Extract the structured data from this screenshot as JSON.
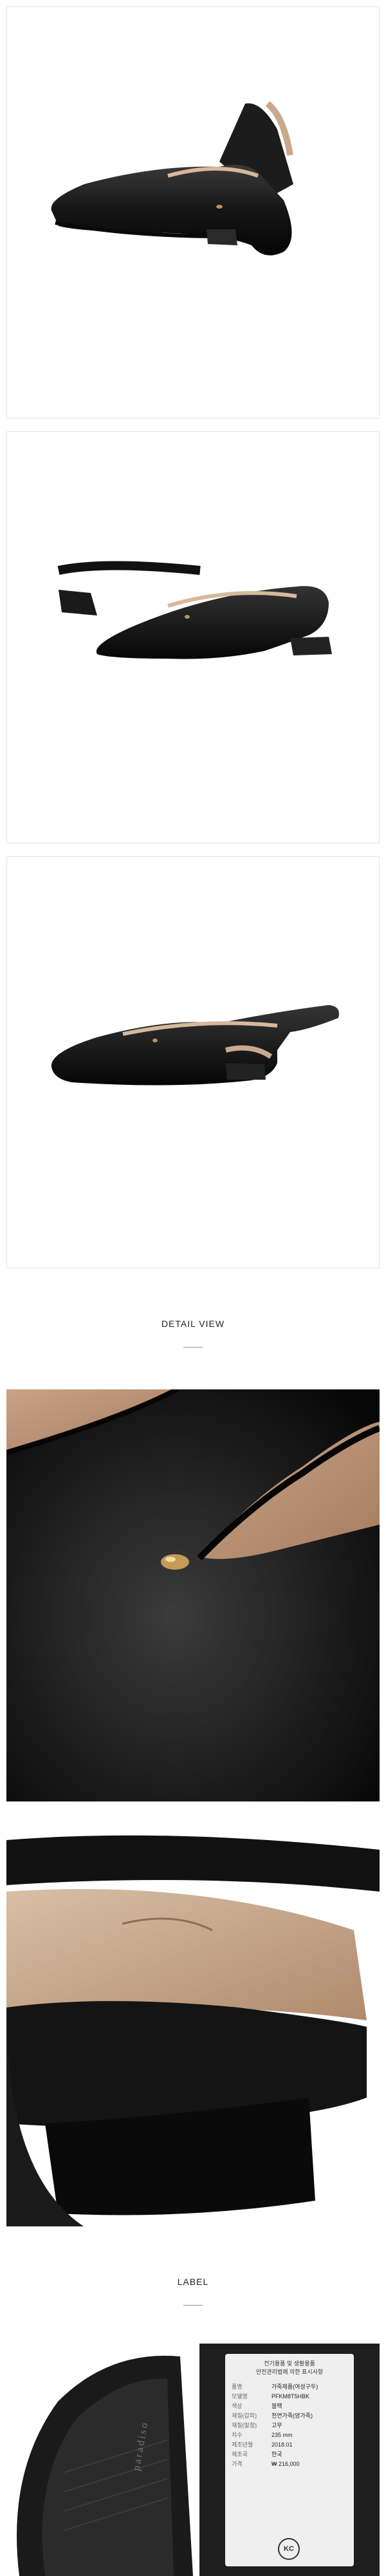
{
  "sections": {
    "detail_heading": "DETAIL VIEW",
    "label_heading": "LABEL"
  },
  "label_card": {
    "title_line1": "전기용품 및 생활용품",
    "title_line2": "안전관리법에 의한 표시사항",
    "rows": [
      {
        "k": "품명",
        "v": "가죽제품(여성구두)"
      },
      {
        "k": "모델명",
        "v": "PFKM8T5HBK"
      },
      {
        "k": "색상",
        "v": "블랙"
      },
      {
        "k": "재질(갑피)",
        "v": "천연가죽(양가죽)"
      },
      {
        "k": "재질(밑창)",
        "v": "고무"
      },
      {
        "k": "치수",
        "v": "235 mm"
      },
      {
        "k": "제조년월",
        "v": "2018.01"
      },
      {
        "k": "제조국",
        "v": "한국"
      },
      {
        "k": "가격",
        "v": "₩ 216,000"
      }
    ],
    "mark": "KC"
  },
  "sole_brand_text": "paradiso"
}
